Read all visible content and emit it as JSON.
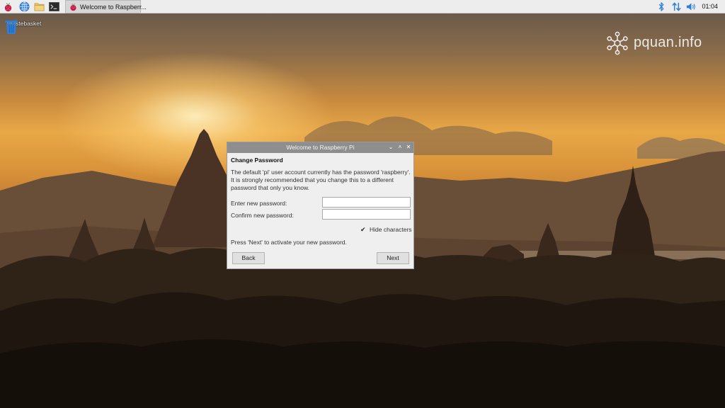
{
  "taskbar": {
    "launchers": [
      {
        "icon": "raspberry-icon"
      },
      {
        "icon": "web-browser-icon"
      },
      {
        "icon": "file-manager-icon"
      },
      {
        "icon": "terminal-icon",
        "glyph": ">_"
      }
    ],
    "active_task": {
      "label": "Welcome to Raspberr...",
      "icon": "raspberry-icon"
    },
    "tray": {
      "icons": [
        "bluetooth-icon",
        "network-icon",
        "volume-icon"
      ],
      "clock": "01:04"
    }
  },
  "desktop": {
    "icons": [
      {
        "label": "Wastebasket",
        "icon": "wastebasket-icon"
      }
    ],
    "watermark": "pquan.info"
  },
  "dialog": {
    "title": "Welcome to Raspberry Pi",
    "heading": "Change Password",
    "body": "The default 'pi' user account currently has the password 'raspberry'. It is strongly recommended that you change this to a different password that only you know.",
    "fields": {
      "new_password": {
        "label": "Enter new password:",
        "value": ""
      },
      "confirm_password": {
        "label": "Confirm new password:",
        "value": ""
      }
    },
    "hide_characters": {
      "label": "Hide characters",
      "checked": true,
      "glyph": "✔"
    },
    "footnote": "Press 'Next' to activate your new password.",
    "buttons": {
      "back": "Back",
      "next": "Next"
    },
    "window_controls": {
      "minimize": "⌄",
      "maximize": "˄",
      "close": "✕"
    }
  },
  "colors": {
    "taskbar_bg": "#ededed",
    "dialog_titlebar": "#8e8e8e",
    "dialog_bg": "#efefef",
    "accent_blue": "#2f7fd6",
    "raspberry_red": "#c51a4a"
  }
}
